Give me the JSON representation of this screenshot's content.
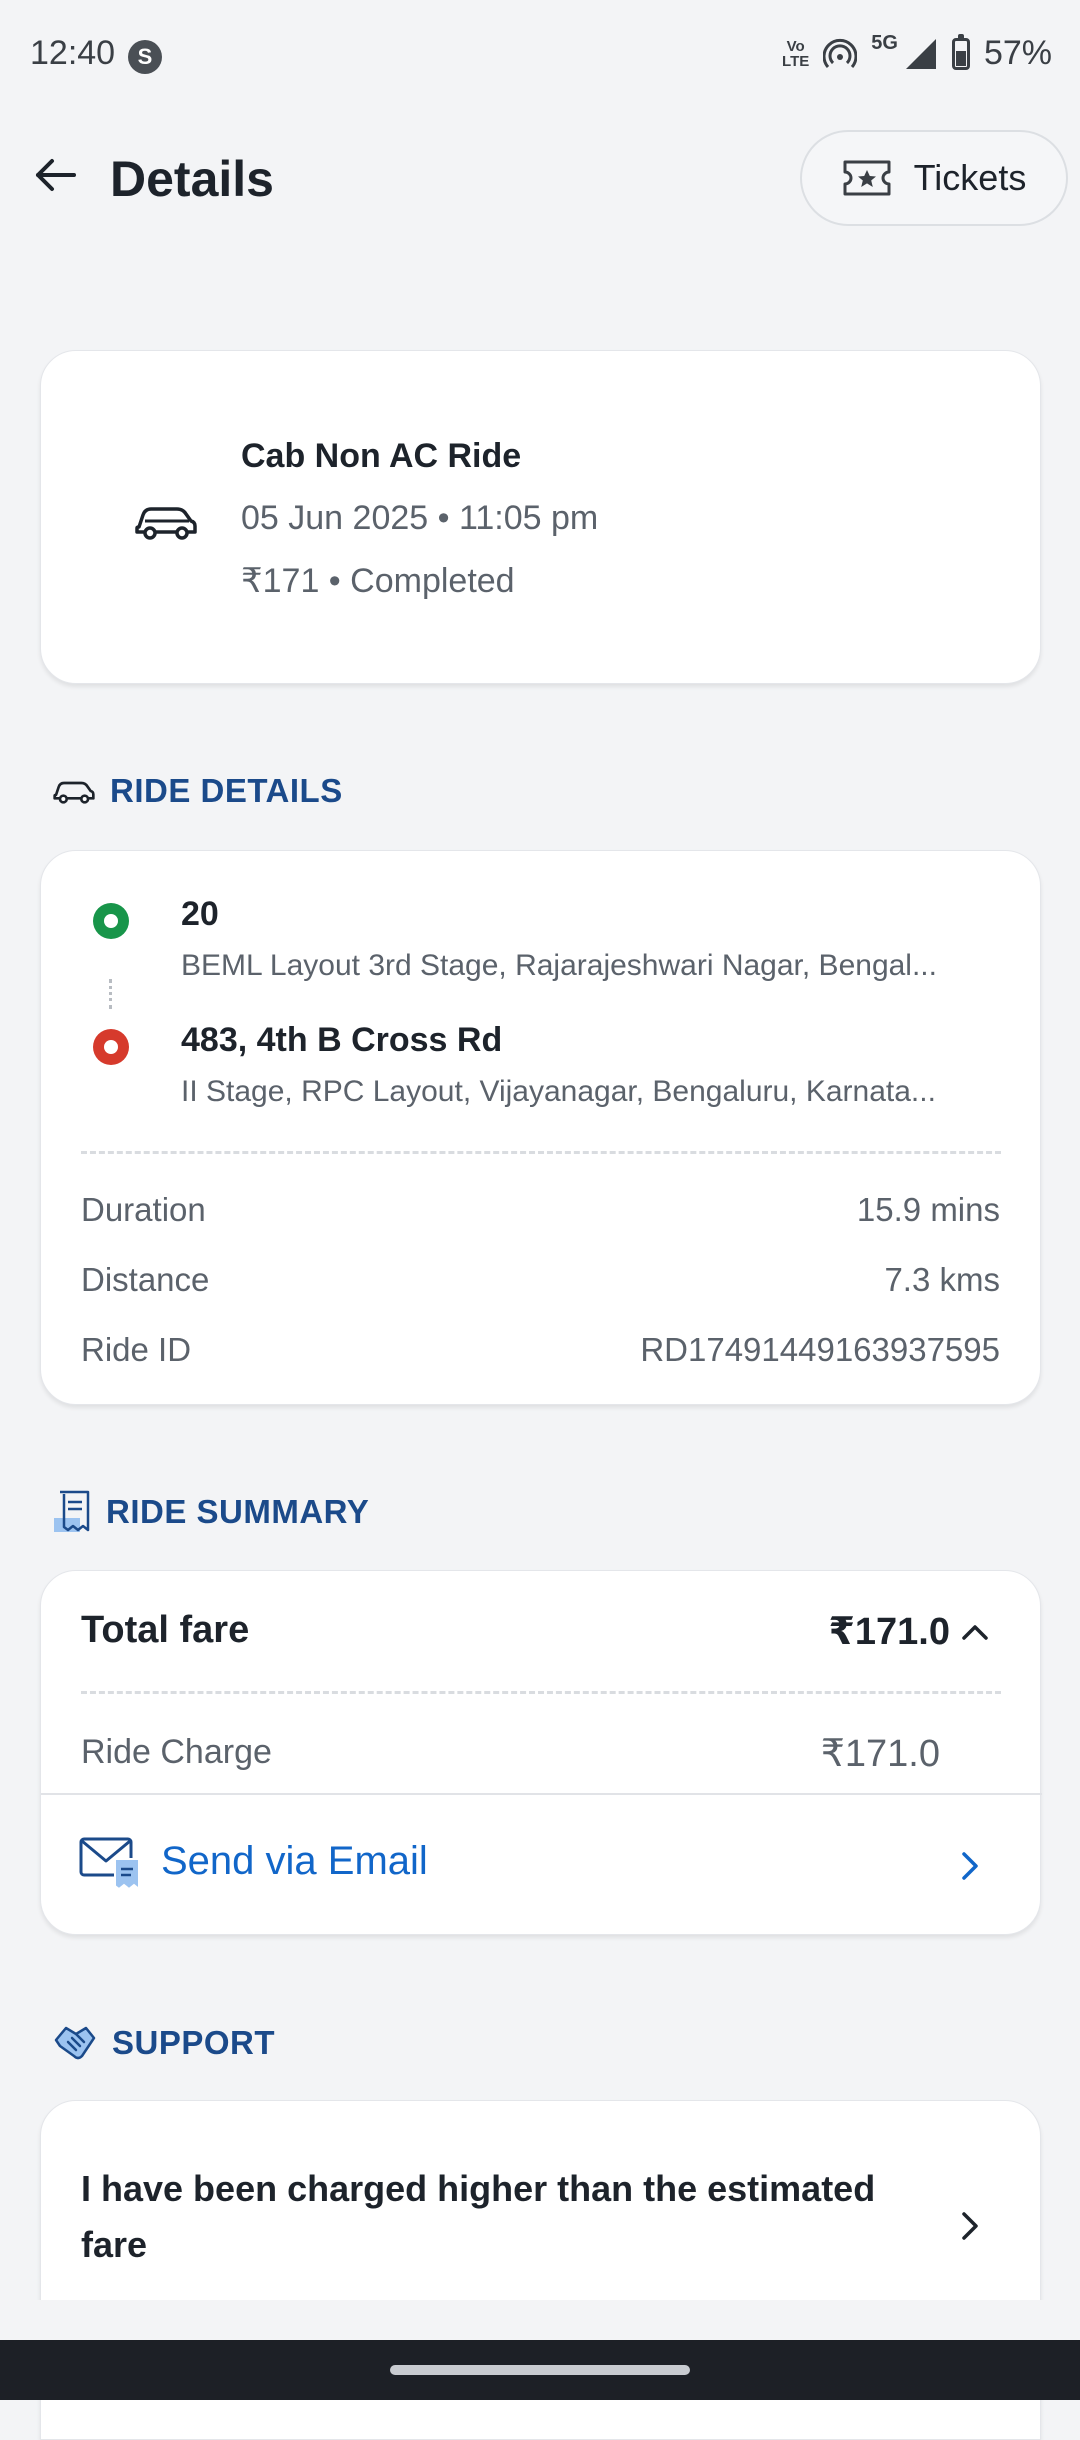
{
  "status_bar": {
    "time": "12:40",
    "app_badge": "S",
    "network": "5G",
    "volte_line1": "Vo",
    "volte_line2": "LTE",
    "battery": "57%"
  },
  "header": {
    "title": "Details",
    "tickets_label": "Tickets"
  },
  "ride": {
    "name": "Cab Non AC Ride",
    "datetime": "05 Jun 2025 • 11:05 pm",
    "status": "₹171 • Completed"
  },
  "ride_details": {
    "heading": "RIDE DETAILS",
    "pickup": {
      "title": "20",
      "address": "BEML Layout 3rd Stage, Rajarajeshwari Nagar, Bengal..."
    },
    "drop": {
      "title": "483, 4th B Cross Rd",
      "address": "II Stage, RPC Layout, Vijayanagar, Bengaluru, Karnata..."
    },
    "rows": [
      {
        "label": "Duration",
        "value": "15.9 mins"
      },
      {
        "label": "Distance",
        "value": "7.3 kms"
      },
      {
        "label": "Ride ID",
        "value": "RD17491449163937595"
      }
    ]
  },
  "ride_summary": {
    "heading": "RIDE SUMMARY",
    "total_label": "Total fare",
    "total_value": "₹171.0",
    "charge_label": "Ride Charge",
    "charge_value": "₹171.0",
    "email_label": "Send via Email"
  },
  "support": {
    "heading": "SUPPORT",
    "item": "I have been charged higher than the estimated fare"
  },
  "colors": {
    "accent_blue": "#1166c9",
    "heading_blue": "#1b4a8a",
    "pickup_green": "#18954a",
    "drop_red": "#d63a2c"
  }
}
